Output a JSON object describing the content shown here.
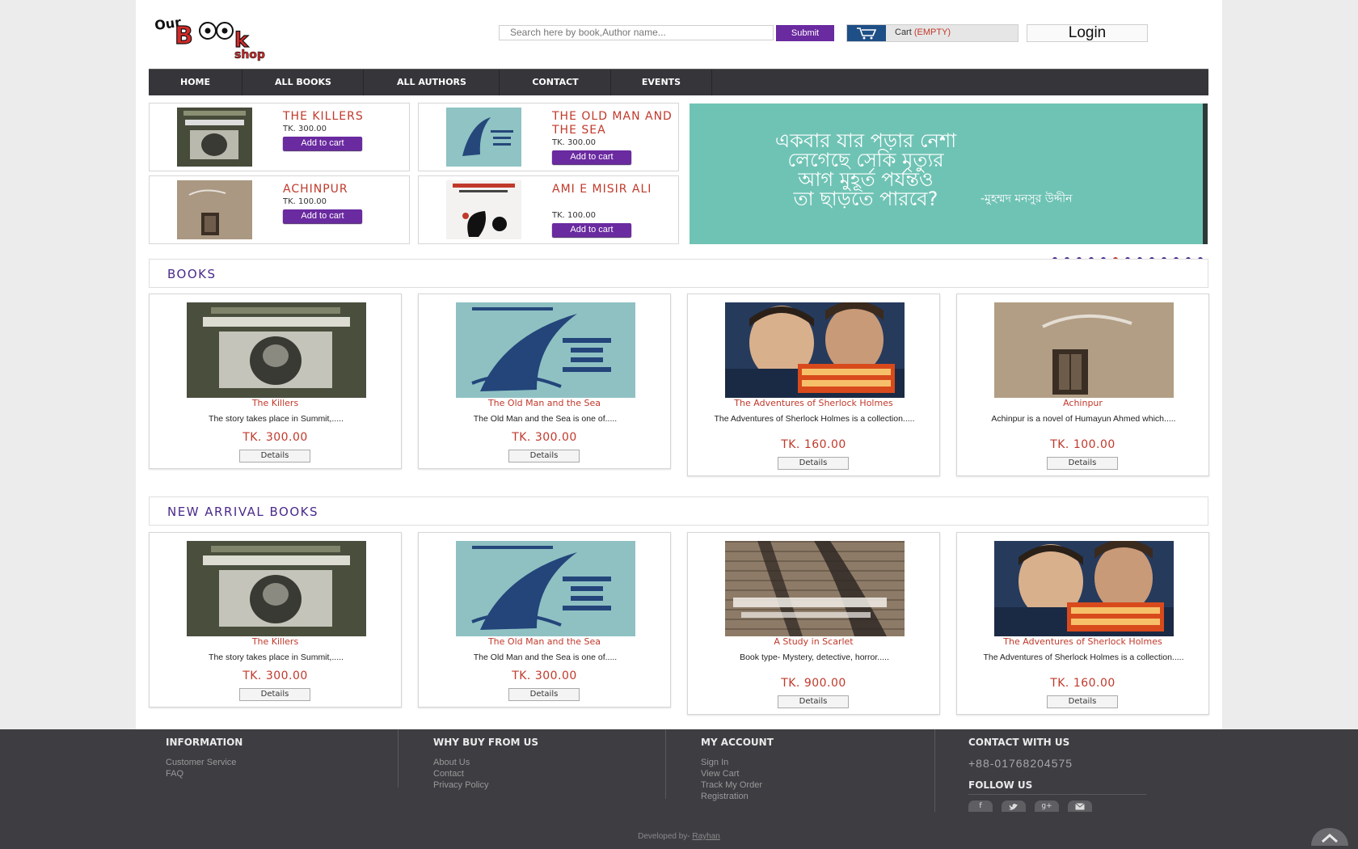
{
  "header": {
    "logo_words": [
      "Our",
      "Book",
      "Shop"
    ],
    "search_placeholder": "Search here by book,Author name...",
    "search_button": "Submit",
    "cart_label": "Cart",
    "cart_status": "(EMPTY)",
    "login_button": "Login"
  },
  "nav": [
    "HOME",
    "ALL BOOKS",
    "ALL AUTHORS",
    "CONTACT",
    "EVENTS"
  ],
  "featured": [
    {
      "title": "THE KILLERS",
      "price": "TK. 300.00",
      "button": "Add to cart"
    },
    {
      "title": "THE OLD MAN AND THE SEA",
      "price": "TK. 300.00",
      "button": "Add to cart"
    },
    {
      "title": "ACHINPUR",
      "price": "TK. 100.00",
      "button": "Add to cart"
    },
    {
      "title": "AMI E MISIR ALI",
      "price": "TK. 100.00",
      "button": "Add to cart"
    }
  ],
  "banner": {
    "quote_lines": [
      "একবার যার পড়ার নেশা",
      "লেগেছে সেকি মৃত্যুর",
      "আগ মুহূর্ত পর্যন্তও",
      "তা ছাড়তে পারবে?"
    ],
    "author": "-মুহম্মদ মনসুর উদ্দীন",
    "slide_count": 13,
    "active_slide": 5
  },
  "sections": {
    "books": "BOOKS",
    "new_arrivals": "NEW ARRIVAL BOOKS"
  },
  "books": [
    {
      "title": "The Killers",
      "desc": "The story takes place in Summit,.....",
      "price": "TK. 300.00",
      "button": "Details",
      "cover": "killers"
    },
    {
      "title": "The Old Man and the Sea",
      "desc": "The Old Man and the Sea is one of.....",
      "price": "TK. 300.00",
      "button": "Details",
      "cover": "oldman"
    },
    {
      "title": "The Adventures of Sherlock Holmes",
      "desc": "The Adventures of Sherlock Holmes is a collection.....",
      "price": "TK. 160.00",
      "button": "Details",
      "cover": "sherlock"
    },
    {
      "title": "Achinpur",
      "desc": "Achinpur is a novel of Humayun Ahmed which.....",
      "price": "TK. 100.00",
      "button": "Details",
      "cover": "achinpur"
    }
  ],
  "new_arrivals": [
    {
      "title": "The Killers",
      "desc": "The story takes place in Summit,.....",
      "price": "TK. 300.00",
      "button": "Details",
      "cover": "killers"
    },
    {
      "title": "The Old Man and the Sea",
      "desc": "The Old Man and the Sea is one of.....",
      "price": "TK. 300.00",
      "button": "Details",
      "cover": "oldman"
    },
    {
      "title": "A Study in Scarlet",
      "desc": "Book type- Mystery, detective, horror.....",
      "price": "TK. 900.00",
      "button": "Details",
      "cover": "scarlet"
    },
    {
      "title": "The Adventures of Sherlock Holmes",
      "desc": "The Adventures of Sherlock Holmes is a collection.....",
      "price": "TK. 160.00",
      "button": "Details",
      "cover": "sherlock"
    }
  ],
  "footer": {
    "information": {
      "heading": "INFORMATION",
      "links": [
        "Customer Service",
        "FAQ"
      ]
    },
    "why_buy": {
      "heading": "WHY BUY FROM US",
      "links": [
        "About Us",
        "Contact",
        "Privacy Policy"
      ]
    },
    "account": {
      "heading": "MY ACCOUNT",
      "links": [
        "Sign In",
        "View Cart",
        "Track My Order",
        "Registration"
      ]
    },
    "contact": {
      "heading": "CONTACT WITH US",
      "phone": "+88-01768204575",
      "follow": "FOLLOW US"
    },
    "social": [
      "f",
      "t",
      "g+",
      "mail"
    ],
    "developed_by": "Developed by-",
    "developer": "Rayhan"
  },
  "colors": {
    "brand_purple": "#6a2aa0",
    "price_red": "#c0392b",
    "nav_bg": "#35353a",
    "banner_bg": "#6fc3b4",
    "footer_bg": "#3d3d42"
  }
}
